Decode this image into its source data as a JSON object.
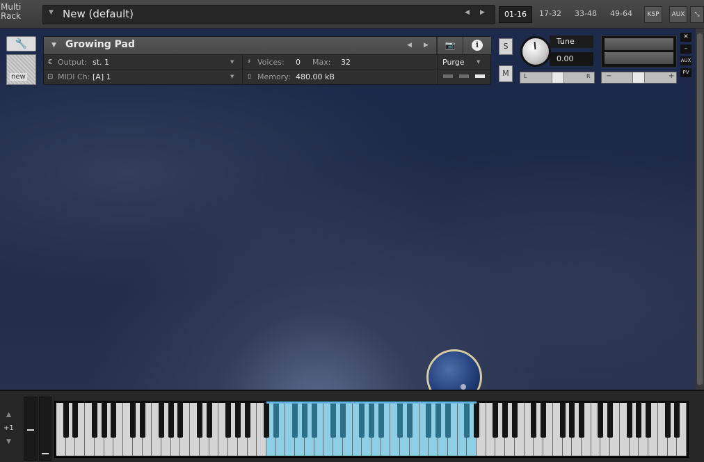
{
  "rack": {
    "label_line1": "Multi",
    "label_line2": "Rack",
    "preset_name": "New (default)",
    "tabs": [
      "01-16",
      "17-32",
      "33-48",
      "49-64"
    ],
    "active_tab": "01-16",
    "ksp_label": "KSP",
    "aux_label": "AUX"
  },
  "instrument": {
    "name": "Growing Pad",
    "output_label": "Output:",
    "output_value": "st. 1",
    "midi_label": "MIDI Ch:",
    "midi_value": "[A]  1",
    "voices_label": "Voices:",
    "voices_value": "0",
    "max_label": "Max:",
    "max_value": "32",
    "memory_label": "Memory:",
    "memory_value": "480.00 kB",
    "purge_label": "Purge",
    "new_label": "new"
  },
  "mixer": {
    "solo": "S",
    "mute": "M",
    "tune_label": "Tune",
    "tune_value": "0.00",
    "pan_left": "L",
    "pan_right": "R",
    "vol_minus": "−",
    "vol_plus": "+",
    "aux_small": "AUX",
    "pv_small": "PV"
  },
  "keyboard": {
    "octave_offset": "+1",
    "white_keys": 66,
    "highlight_start_white": 22,
    "highlight_count_white": 22,
    "highlight_color": "#8fcfe6"
  },
  "colors": {
    "accent": "#5fb9dc",
    "background_top": "#1d2a4c"
  }
}
